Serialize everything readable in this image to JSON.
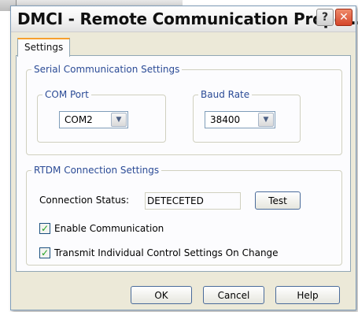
{
  "window": {
    "title": "DMCI - Remote Communication Proper...",
    "help_label": "?",
    "close_label": "✕"
  },
  "tabs": [
    {
      "label": "Settings",
      "active": true
    }
  ],
  "serial": {
    "legend": "Serial Communication Settings",
    "com_port": {
      "legend": "COM Port",
      "value": "COM2"
    },
    "baud_rate": {
      "legend": "Baud Rate",
      "value": "38400"
    }
  },
  "rtdm": {
    "legend": "RTDM Connection Settings",
    "status_label": "Connection Status:",
    "status_value": "DETECETED",
    "test_label": "Test",
    "enable_comm": {
      "label": "Enable Communication",
      "checked": true
    },
    "transmit": {
      "label": "Transmit Individual Control Settings On Change",
      "checked": true
    }
  },
  "footer": {
    "ok_label": "OK",
    "cancel_label": "Cancel",
    "help_label": "Help"
  },
  "icons": {
    "dropdown": "chevron-down-icon",
    "check": "check-icon"
  }
}
